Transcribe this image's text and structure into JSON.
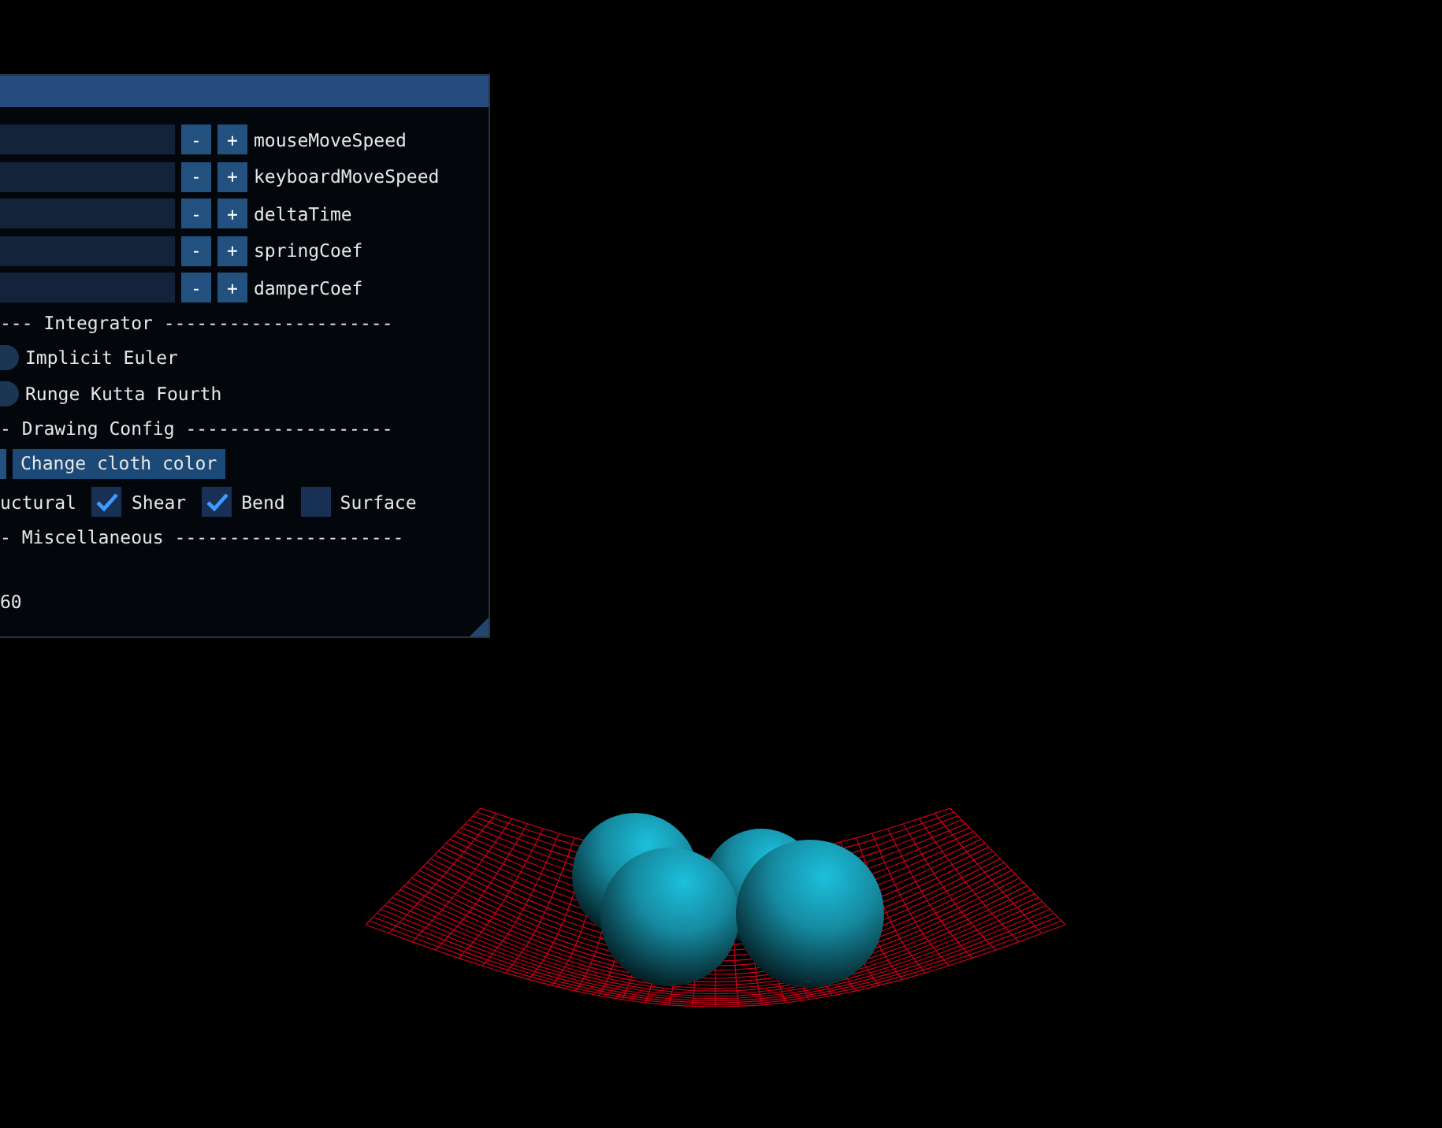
{
  "panel": {
    "params": [
      {
        "minus": "-",
        "plus": "+",
        "label": "mouseMoveSpeed"
      },
      {
        "minus": "-",
        "plus": "+",
        "label": "keyboardMoveSpeed"
      },
      {
        "minus": "-",
        "plus": "+",
        "label": "deltaTime"
      },
      {
        "minus": "-",
        "plus": "+",
        "label": "springCoef"
      },
      {
        "minus": "-",
        "plus": "+",
        "label": "damperCoef"
      }
    ],
    "integrator_header": "--- Integrator ---------------------",
    "integrators": [
      {
        "label": "Implicit Euler",
        "selected": false
      },
      {
        "label": "Runge Kutta Fourth",
        "selected": false
      }
    ],
    "drawing_header": "- Drawing Config -------------------",
    "color_button": "Change cloth color",
    "springs": [
      {
        "label": "uctural",
        "kind": "label"
      },
      {
        "label": "Shear",
        "kind": "checkbox",
        "checked": true
      },
      {
        "label": "Bend",
        "kind": "checkbox",
        "checked": true
      },
      {
        "label": "Surface",
        "kind": "checkbox",
        "checked": false
      }
    ],
    "misc_header": "- Miscellaneous ---------------------",
    "misc_value": "60"
  }
}
